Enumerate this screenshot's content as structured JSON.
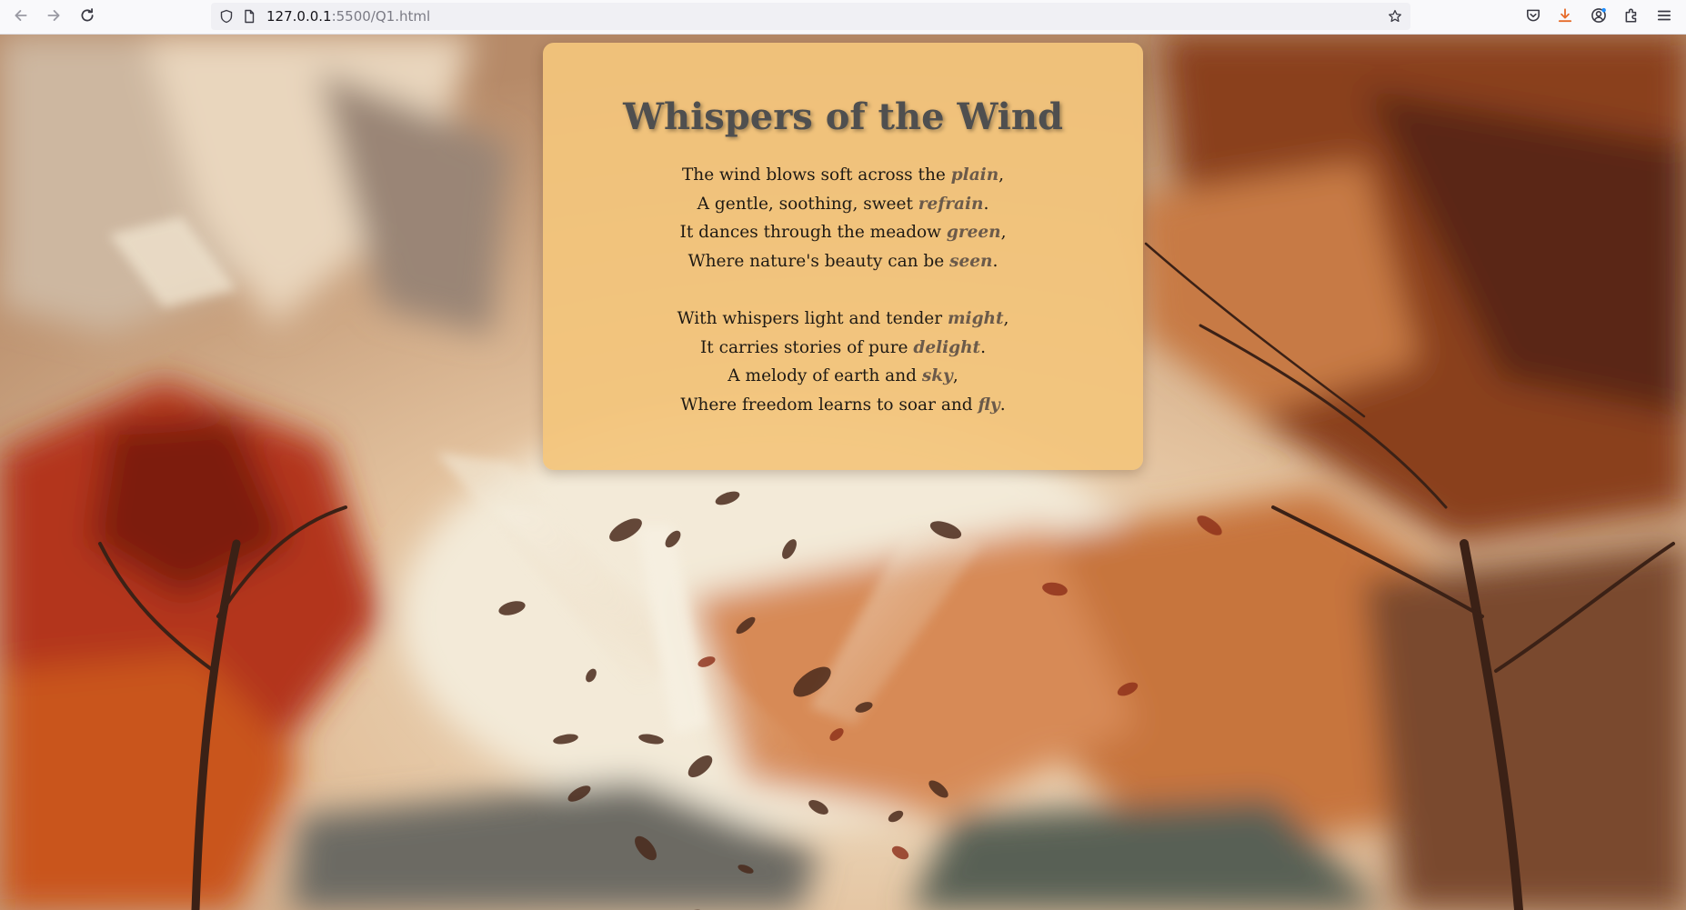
{
  "browser": {
    "url_host": "127.0.0.1",
    "url_path": ":5500/Q1.html"
  },
  "poem": {
    "title": "Whispers of the Wind",
    "stanzas": [
      {
        "lines": [
          {
            "before": "The wind blows soft across the ",
            "keyword": "plain",
            "after": ","
          },
          {
            "before": "A gentle, soothing, sweet ",
            "keyword": "refrain",
            "after": "."
          },
          {
            "before": "It dances through the meadow ",
            "keyword": "green",
            "after": ","
          },
          {
            "before": "Where nature's beauty can be ",
            "keyword": "seen",
            "after": "."
          }
        ]
      },
      {
        "lines": [
          {
            "before": "With whispers light and tender ",
            "keyword": "might",
            "after": ","
          },
          {
            "before": "It carries stories of pure ",
            "keyword": "delight",
            "after": "."
          },
          {
            "before": "A melody of earth and ",
            "keyword": "sky",
            "after": ","
          },
          {
            "before": "Where freedom learns to soar and ",
            "keyword": "fly",
            "after": "."
          }
        ]
      }
    ]
  },
  "colors": {
    "card_background": "#f3c57c",
    "title": "#4f4f4f",
    "keyword": "#6b5a4a",
    "toolbar": "#f9f9fb",
    "download_accent": "#e66b2a"
  },
  "icons": {
    "back": "arrow-left-icon",
    "forward": "arrow-right-icon",
    "reload": "reload-icon",
    "tracking_protection": "shield-icon",
    "page_info": "document-icon",
    "bookmark": "star-icon",
    "pocket": "pocket-icon",
    "downloads": "download-icon",
    "account": "account-icon",
    "extensions": "puzzle-icon",
    "menu": "hamburger-menu-icon"
  }
}
